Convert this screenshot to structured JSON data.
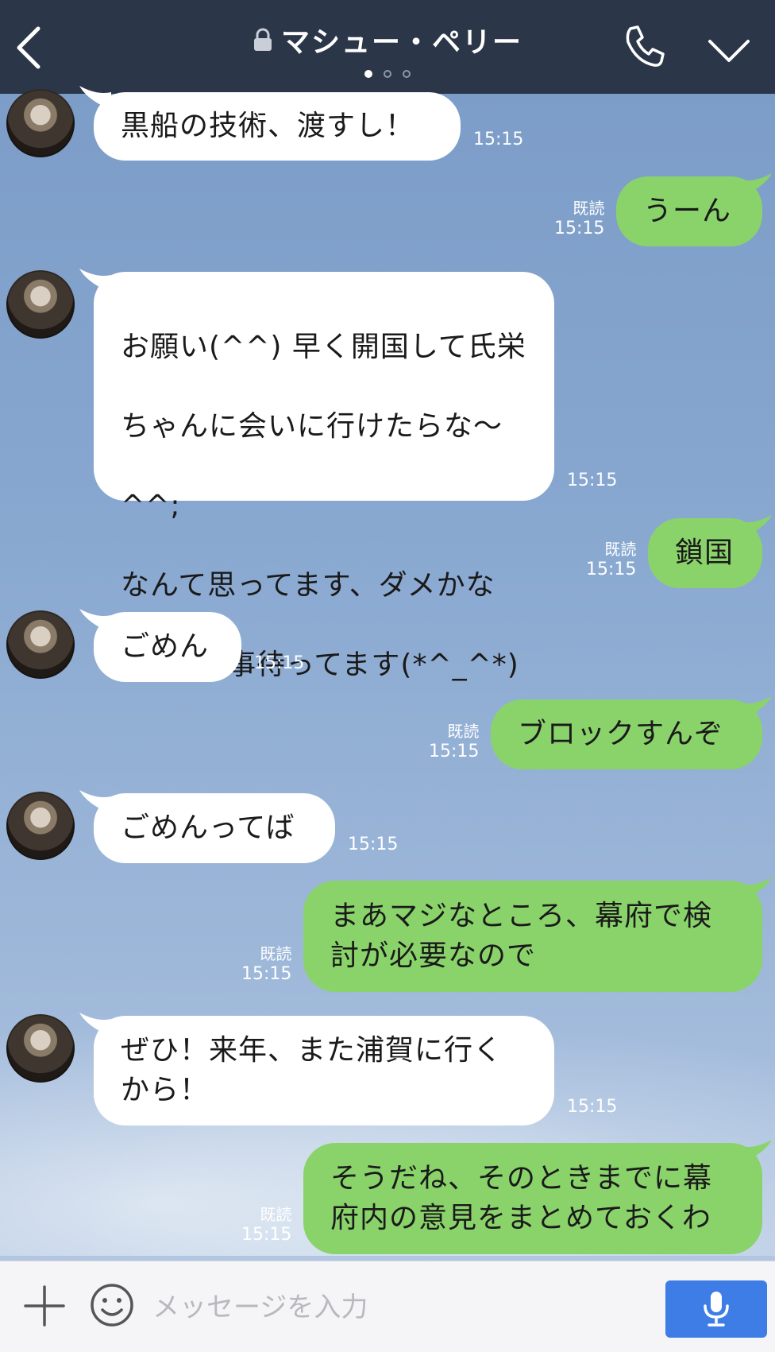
{
  "header": {
    "back_icon": "chevron-left-icon",
    "lock_icon": "lock-icon",
    "title": "マシュー・ペリー",
    "call_icon": "phone-icon",
    "menu_icon": "chevron-down-icon",
    "page_indicator": {
      "count": 3,
      "active": 0
    }
  },
  "messages": [
    {
      "side": "left",
      "text": "黒船の技術、渡すし！",
      "time": "15:15"
    },
    {
      "side": "right",
      "read": "既読",
      "text": "うーん",
      "time": "15:15"
    },
    {
      "side": "left",
      "line1": "お願い(^^) 早く開国して氏栄",
      "line2": "ちゃんに会いに行けたらな〜",
      "line3": "^^;",
      "line4": "なんて思ってます、ダメかな",
      "line5": "お返事待ってます(*^_^*)",
      "emoji_icon": "sweat-droplets-icon",
      "time": "15:15"
    },
    {
      "side": "right",
      "read": "既読",
      "text": "鎖国",
      "time": "15:15"
    },
    {
      "side": "left",
      "text": "ごめん",
      "time": "15:15"
    },
    {
      "side": "right",
      "read": "既読",
      "text": "ブロックすんぞ",
      "time": "15:15"
    },
    {
      "side": "left",
      "text": "ごめんってば",
      "time": "15:15"
    },
    {
      "side": "right",
      "read": "既読",
      "text": "まあマジなところ、幕府で検\n討が必要なので",
      "time": "15:15"
    },
    {
      "side": "left",
      "text": "ぜひ！来年、また浦賀に行く\nから！",
      "time": "15:15"
    },
    {
      "side": "right",
      "read": "既読",
      "text": "そうだね、そのときまでに幕\n府内の意見をまとめておくわ",
      "time": "15:15"
    }
  ],
  "input": {
    "plus_icon": "plus-icon",
    "sticker_icon": "smiley-icon",
    "placeholder": "メッセージを入力",
    "mic_icon": "microphone-icon"
  },
  "colors": {
    "header_bg": "#2b3648",
    "bubble_left": "#ffffff",
    "bubble_right": "#8ad36b",
    "mic_button": "#3f7de6"
  }
}
